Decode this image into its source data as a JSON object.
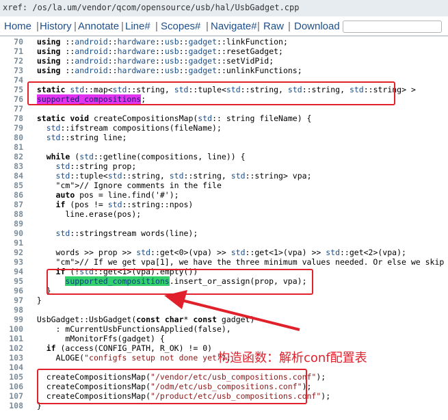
{
  "xref": "xref: /os/la.um/vendor/qcom/opensource/usb/hal/UsbGadget.cpp",
  "nav": {
    "items": [
      "Home",
      "History",
      "Annotate",
      "Line#",
      "Scopes#",
      "Navigate#",
      "Raw",
      "Download"
    ],
    "search_placeholder": ""
  },
  "lines": [
    {
      "n": "70",
      "t": "  using ::android::hardware::usb::gadget::linkFunction;"
    },
    {
      "n": "71",
      "t": "  using ::android::hardware::usb::gadget::resetGadget;"
    },
    {
      "n": "72",
      "t": "  using ::android::hardware::usb::gadget::setVidPid;"
    },
    {
      "n": "73",
      "t": "  using ::android::hardware::usb::gadget::unlinkFunctions;"
    },
    {
      "n": "74",
      "t": ""
    },
    {
      "n": "75",
      "t": "  static std::map<std::string, std::tuple<std::string, std::string, std::string> >"
    },
    {
      "n": "76",
      "t": "  supported_compositions;"
    },
    {
      "n": "77",
      "t": ""
    },
    {
      "n": "78",
      "t": "  static void createCompositionsMap(std:: string fileName) {"
    },
    {
      "n": "79",
      "t": "    std::ifstream compositions(fileName);"
    },
    {
      "n": "80",
      "t": "    std::string line;"
    },
    {
      "n": "81",
      "t": ""
    },
    {
      "n": "82",
      "t": "    while (std::getline(compositions, line)) {"
    },
    {
      "n": "83",
      "t": "      std::string prop;"
    },
    {
      "n": "84",
      "t": "      std::tuple<std::string, std::string, std::string> vpa;"
    },
    {
      "n": "85",
      "t": "      // Ignore comments in the file"
    },
    {
      "n": "86",
      "t": "      auto pos = line.find('#');"
    },
    {
      "n": "87",
      "t": "      if (pos != std::string::npos)"
    },
    {
      "n": "88",
      "t": "        line.erase(pos);"
    },
    {
      "n": "89",
      "t": ""
    },
    {
      "n": "90",
      "t": "      std::stringstream words(line);"
    },
    {
      "n": "91",
      "t": ""
    },
    {
      "n": "92",
      "t": "      words >> prop >> std::get<0>(vpa) >> std::get<1>(vpa) >> std::get<2>(vpa);"
    },
    {
      "n": "93",
      "t": "      // If we get vpa[1], we have the three minimum values needed. Or else we skip"
    },
    {
      "n": "94",
      "t": "      if (!std::get<1>(vpa).empty())"
    },
    {
      "n": "95",
      "t": "        supported_compositions.insert_or_assign(prop, vpa);"
    },
    {
      "n": "96",
      "t": "    }"
    },
    {
      "n": "97",
      "t": "  }"
    },
    {
      "n": "98",
      "t": ""
    },
    {
      "n": "99",
      "t": "  UsbGadget::UsbGadget(const char* const gadget)"
    },
    {
      "n": "100",
      "t": "      : mCurrentUsbFunctionsApplied(false),"
    },
    {
      "n": "101",
      "t": "        mMonitorFfs(gadget) {"
    },
    {
      "n": "102",
      "t": "    if (access(CONFIG_PATH, R_OK) != 0)"
    },
    {
      "n": "103",
      "t": "      ALOGE(\"configfs setup not done yet\");"
    },
    {
      "n": "104",
      "t": ""
    },
    {
      "n": "105",
      "t": "    createCompositionsMap(\"/vendor/etc/usb_compositions.conf\");"
    },
    {
      "n": "106",
      "t": "    createCompositionsMap(\"/odm/etc/usb_compositions.conf\");"
    },
    {
      "n": "107",
      "t": "    createCompositionsMap(\"/product/etc/usb_compositions.conf\");"
    },
    {
      "n": "108",
      "t": "  }"
    }
  ],
  "annotation": "构造函数：解析conf配置表",
  "colors": {
    "highlight_magenta": "#e234f0",
    "highlight_green": "#33d16c",
    "annotation_red": "#e0202a",
    "nav_link": "#1c4f8c"
  }
}
